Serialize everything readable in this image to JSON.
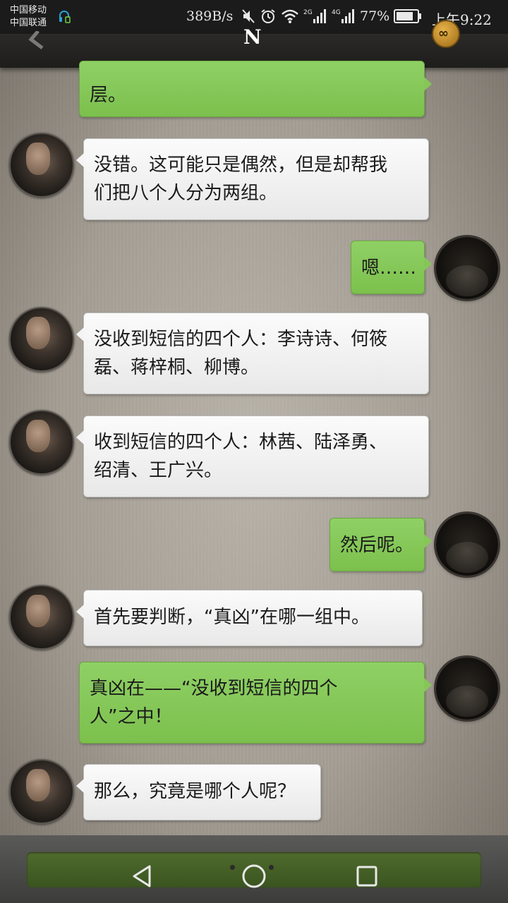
{
  "status_bar": {
    "carrier_1": "中国移动",
    "carrier_2": "中国联通",
    "net_speed": "389B/s",
    "battery_pct": "77%",
    "time": "上午9:22",
    "icons": [
      "headset-icon",
      "mute-icon",
      "alarm-icon",
      "wifi-icon",
      "signal-2g-icon",
      "signal-4g-icon",
      "battery-icon"
    ]
  },
  "title_bar": {
    "app_logo": "N",
    "back_icon": "chevron-left-icon",
    "badge_icon": "infinity-badge-icon",
    "badge_text": "∞"
  },
  "chat": {
    "messages": [
      {
        "side": "right",
        "text": "层。",
        "partial": true
      },
      {
        "side": "left",
        "lines": [
          "没错。这可能只是偶然，但是却帮我",
          "们把八个人分为两组。"
        ]
      },
      {
        "side": "right",
        "lines": [
          "嗯……"
        ]
      },
      {
        "side": "left",
        "lines": [
          "没收到短信的四个人：李诗诗、何筱",
          "磊、蒋梓桐、柳博。"
        ]
      },
      {
        "side": "left",
        "lines": [
          "收到短信的四个人：林茜、陆泽勇、",
          "绍清、王广兴。"
        ]
      },
      {
        "side": "right",
        "lines": [
          "然后呢。"
        ]
      },
      {
        "side": "left",
        "lines": [
          "首先要判断，“真凶”在哪一组中。"
        ]
      },
      {
        "side": "right",
        "lines": [
          "真凶在——“没收到短信的四个",
          "人”之中！"
        ]
      },
      {
        "side": "left",
        "lines": [
          "那么，究竟是哪个人呢？"
        ]
      }
    ]
  },
  "nav_bar": {
    "buttons": [
      "back-triangle-icon",
      "home-circle-icon",
      "recents-square-icon"
    ]
  },
  "colors": {
    "bubble_right": "#85c757",
    "bubble_left": "#f4f4f4",
    "status_bar_bg": "#1b1b1b",
    "nav_inner": "#4f6b2c"
  }
}
